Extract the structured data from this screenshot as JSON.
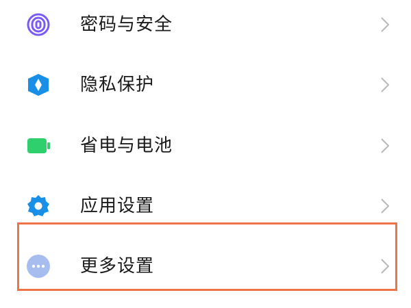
{
  "settings_items": [
    {
      "label": "密码与安全",
      "icon": "fingerprint-icon",
      "icon_color": "#7a5af5"
    },
    {
      "label": "隐私保护",
      "icon": "privacy-shield-icon",
      "icon_color": "#1a8fe8"
    },
    {
      "label": "省电与电池",
      "icon": "battery-icon",
      "icon_color": "#2fcf6e"
    },
    {
      "label": "应用设置",
      "icon": "gear-icon",
      "icon_color": "#1a8fe8"
    },
    {
      "label": "更多设置",
      "icon": "more-dots-icon",
      "icon_color": "#a7bdf0"
    }
  ],
  "highlight_color": "#f07346"
}
